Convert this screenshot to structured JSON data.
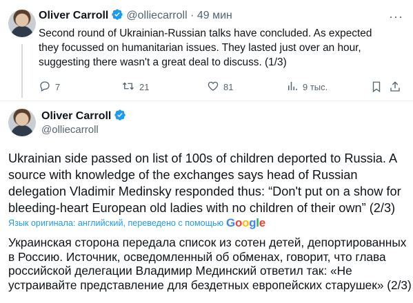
{
  "tweet1": {
    "author_name": "Oliver Carroll",
    "handle": "@olliecarroll",
    "separator": "·",
    "time": "49 мин",
    "text": "Second round of Ukrainian-Russian talks have concluded. As expected they focussed on humanitarian issues. They lasted just over an hour, suggesting there wasn't a great deal to discuss. (1/3)",
    "more_label": "···",
    "actions": {
      "replies": "7",
      "retweets": "21",
      "likes": "81",
      "views": "9 тыс."
    }
  },
  "tweet2": {
    "author_name": "Oliver Carroll",
    "handle": "@olliecarroll",
    "text": "Ukrainian side passed on list of 100s of children deported to Russia. A source with knowledge of the exchanges says head of Russian delegation Vladimir Medinsky responded thus: “Don't put on a show for bleeding-heart European old ladies with no children of their own” (2/3)",
    "translation_note": "Язык оригинала: английский, переведено с помощью",
    "translation_provider": "Google",
    "translated_text": "Украинская сторона передала список из сотен детей, депортированных в Россию. Источник, осведомленный об обменах, говорит, что глава российской делегации Владимир Мединский ответил так: «Не устраивайте представление для бездетных европейских старушек» (2/3)"
  },
  "colors": {
    "accent": "#1d9bf0",
    "text": "#0f1419",
    "muted": "#536471"
  }
}
